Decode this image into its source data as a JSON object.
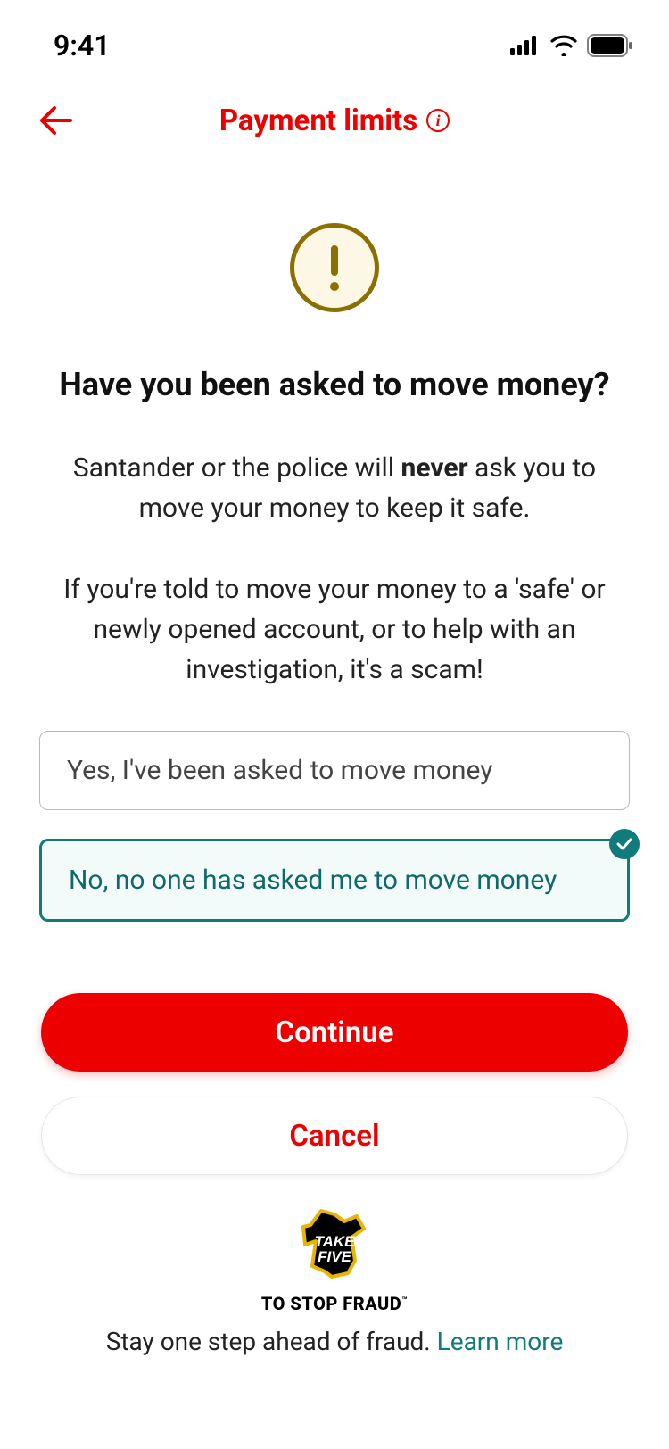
{
  "status": {
    "time": "9:41"
  },
  "header": {
    "title": "Payment limits"
  },
  "main": {
    "heading": "Have you been asked to move money?",
    "para1_pre": "Santander or the police will ",
    "para1_strong": "never",
    "para1_post": " ask you to move your money to keep it safe.",
    "para2": "If you're told to move your money to a 'safe' or newly opened account, or to help with an investigation, it's a scam!"
  },
  "options": {
    "opt1": "Yes, I've been asked to move money",
    "opt2": "No, no one has asked me to move money"
  },
  "actions": {
    "continue": "Continue",
    "cancel": "Cancel"
  },
  "footer": {
    "logo_line1": "TAKE",
    "logo_line2": "FIVE",
    "logo_sub": "TO STOP FRAUD",
    "text": "Stay one step ahead of fraud. ",
    "link": "Learn more"
  }
}
